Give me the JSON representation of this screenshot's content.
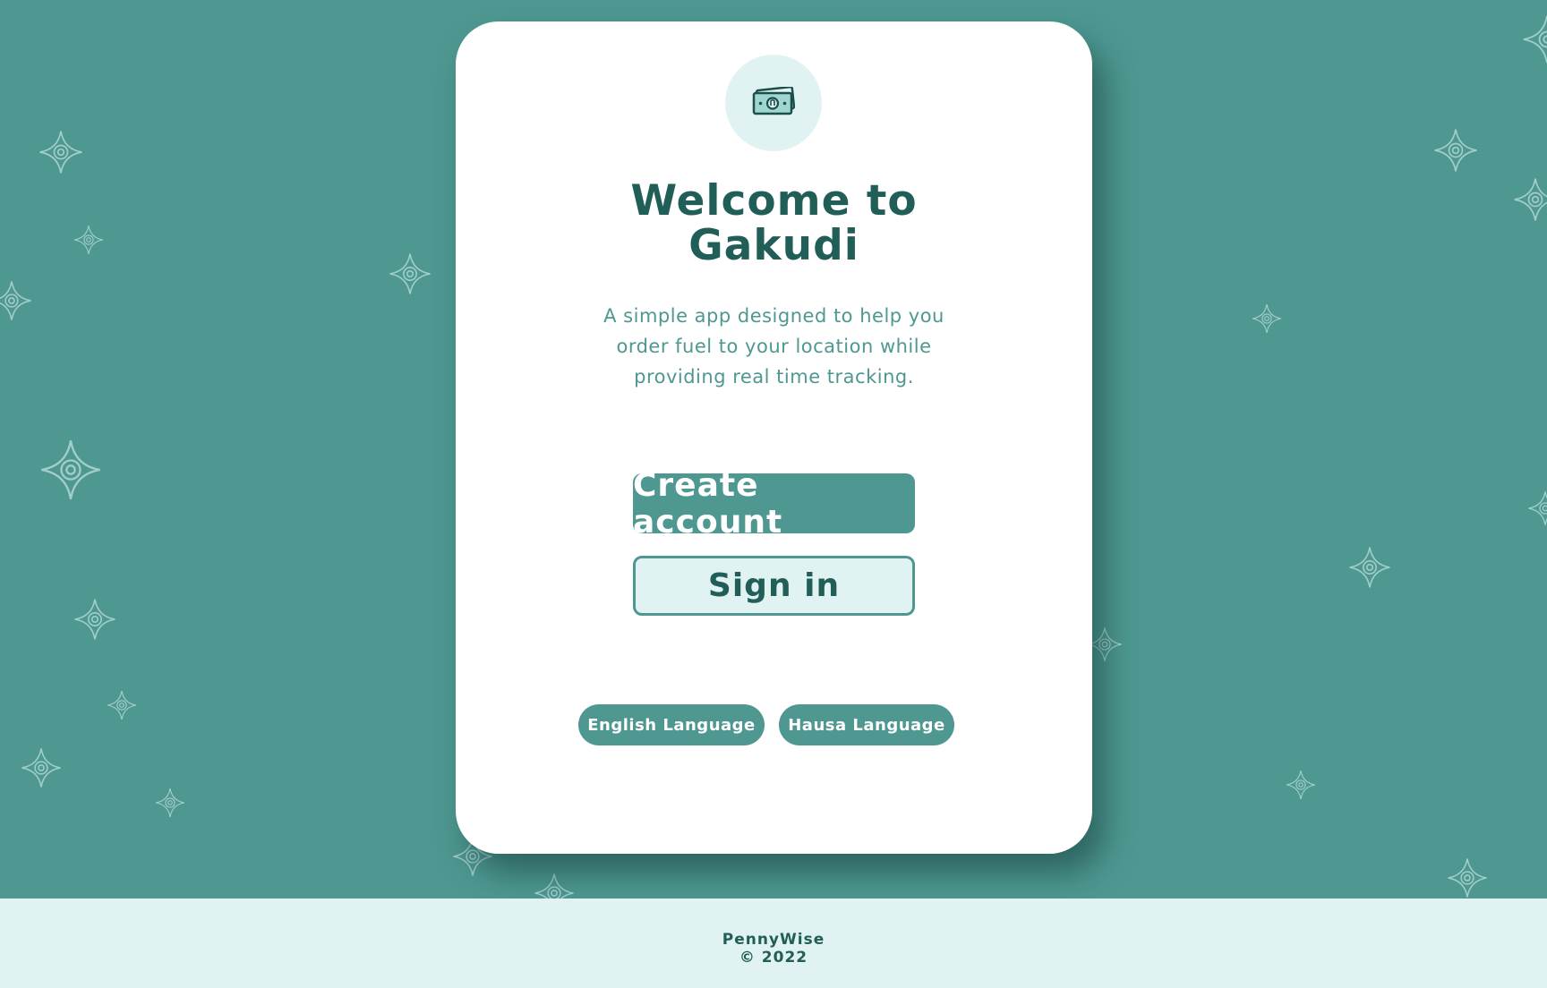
{
  "app": {
    "title_line1": "Welcome to",
    "title_line2": "Gakudi",
    "tagline_line1": "A simple app designed to help you",
    "tagline_line2": "order fuel to your location while",
    "tagline_line3": "providing real time tracking.",
    "logo_icon": "money-bill-icon"
  },
  "actions": {
    "create_account": "Create account",
    "sign_in": "Sign in"
  },
  "languages": {
    "english": "English Language",
    "hausa": "Hausa Language"
  },
  "footer": {
    "brand": "PennyWise",
    "copyright": "© 2022"
  },
  "colors": {
    "background": "#4e9891",
    "card": "#ffffff",
    "primary": "#4e9891",
    "dark_text": "#215e58",
    "light_accent": "#e0f3f2"
  }
}
